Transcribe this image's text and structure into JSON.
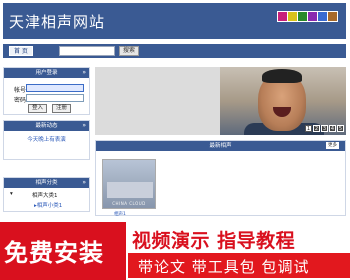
{
  "header": {
    "site_title": "天津相声网站",
    "theme_swatches": [
      "#c8207a",
      "#d8c21a",
      "#2a8a2a",
      "#8a2ab0",
      "#3a6ad0",
      "#a86a2a"
    ]
  },
  "nav": {
    "home_label": "首 页",
    "category_label": "",
    "search_value": "",
    "search_button_label": "搜索"
  },
  "login": {
    "heading": "用户登录",
    "account_label": "帐号",
    "password_label": "密码",
    "login_button_label": "登入",
    "register_button_label": "注册"
  },
  "news": {
    "heading": "最新动态",
    "items": [
      "今天晚上有表演"
    ]
  },
  "categories": {
    "heading": "相声分类",
    "items": [
      {
        "label": "相声大类1",
        "sub": false
      },
      {
        "label": "相声小类1",
        "sub": true
      }
    ]
  },
  "banner": {
    "pages": [
      "1",
      "2",
      "3",
      "4",
      "5"
    ],
    "current_page": "1"
  },
  "latest": {
    "heading": "最新相声",
    "more_label": "更多",
    "items": [
      {
        "caption": "CHINA CLOUD",
        "label": "相声1"
      }
    ]
  },
  "promo": {
    "left_text": "免费安装",
    "right_top_text": "视频演示 指导教程",
    "right_bottom_text": "带论文 带工具包 包调试"
  }
}
